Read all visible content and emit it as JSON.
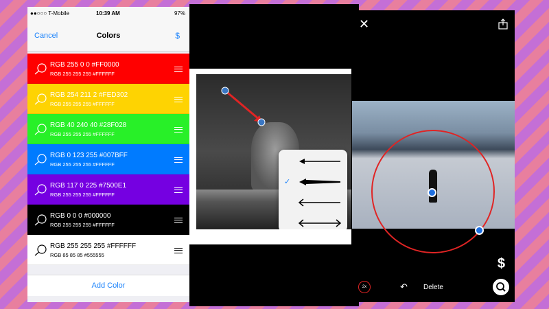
{
  "status_bar": {
    "carrier": "●●○○○ T-Mobile",
    "time": "10:39 AM",
    "battery": "97%"
  },
  "nav": {
    "cancel": "Cancel",
    "title": "Colors",
    "dollar": "$"
  },
  "colors": [
    {
      "line1": "RGB 255 0 0   #FF0000",
      "line2": "RGB 255 255 255   #FFFFFF",
      "bg": "#FF0000",
      "fg": "#FFFFFF"
    },
    {
      "line1": "RGB 254 211 2   #FED302",
      "line2": "RGB 255 255 255   #FFFFFF",
      "bg": "#FED302",
      "fg": "#FFFFFF"
    },
    {
      "line1": "RGB 40 240 40   #28F028",
      "line2": "RGB 255 255 255   #FFFFFF",
      "bg": "#28F028",
      "fg": "#FFFFFF"
    },
    {
      "line1": "RGB 0 123 255   #007BFF",
      "line2": "RGB 255 255 255   #FFFFFF",
      "bg": "#007BFF",
      "fg": "#FFFFFF"
    },
    {
      "line1": "RGB 117 0 225   #7500E1",
      "line2": "RGB 255 255 255   #FFFFFF",
      "bg": "#7500E1",
      "fg": "#FFFFFF"
    },
    {
      "line1": "RGB 0 0 0   #000000",
      "line2": "RGB 255 255 255   #FFFFFF",
      "bg": "#000000",
      "fg": "#FFFFFF"
    },
    {
      "line1": "RGB 255 255 255   #FFFFFF",
      "line2": "RGB 85 85 85   #555555",
      "bg": "#FFFFFF",
      "fg": "#000000"
    }
  ],
  "add_color": "Add Color",
  "editor2": {
    "arrow_options": [
      "left-arrow",
      "left-arrow-heavy",
      "left-arrow-open",
      "double-arrow"
    ],
    "selected_option": 1,
    "accent": "#E02424"
  },
  "editor3": {
    "delete": "Delete",
    "zoom_badge": "2x",
    "dollar": "$"
  }
}
